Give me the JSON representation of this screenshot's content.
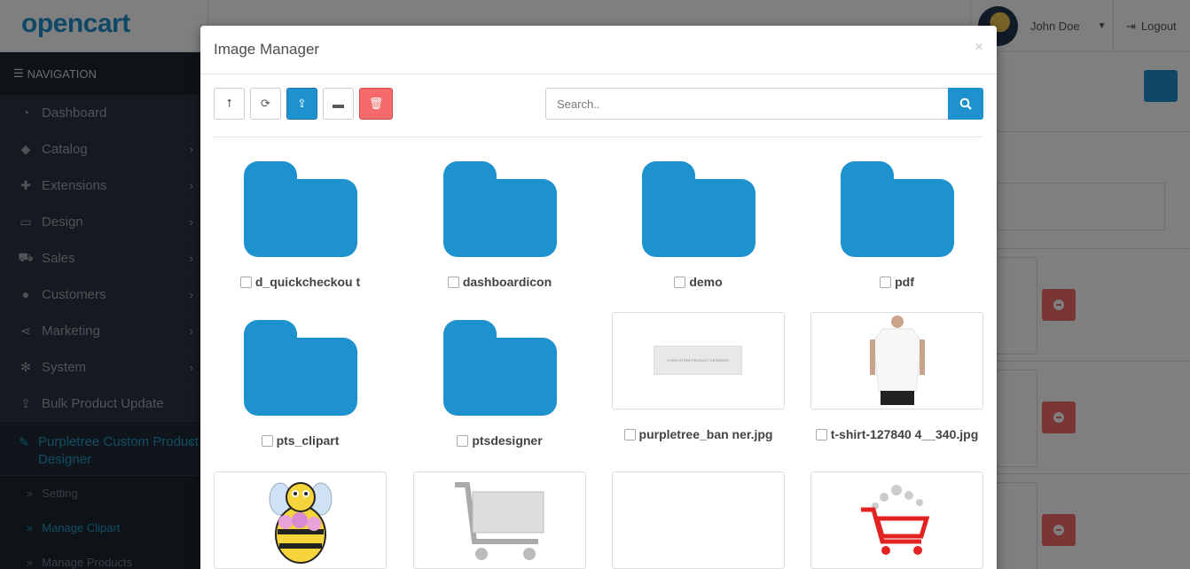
{
  "app": {
    "logo_text": "opencart",
    "logo_cart": "⌐.:",
    "user_name": "John Doe",
    "logout_label": "Logout"
  },
  "sidebar": {
    "heading": "NAVIGATION",
    "items": [
      {
        "label": "Dashboard",
        "icon": "dashboard-icon",
        "glyph": "◔"
      },
      {
        "label": "Catalog",
        "icon": "tag-icon",
        "glyph": "◆"
      },
      {
        "label": "Extensions",
        "icon": "puzzle-icon",
        "glyph": "✚"
      },
      {
        "label": "Design",
        "icon": "monitor-icon",
        "glyph": "▭"
      },
      {
        "label": "Sales",
        "icon": "cart-icon",
        "glyph": "⛟"
      },
      {
        "label": "Customers",
        "icon": "user-icon",
        "glyph": "●"
      },
      {
        "label": "Marketing",
        "icon": "share-icon",
        "glyph": "⋖"
      },
      {
        "label": "System",
        "icon": "cog-icon",
        "glyph": "✻"
      },
      {
        "label": "Bulk Product Update",
        "icon": "upload-icon",
        "glyph": "⇪"
      },
      {
        "label": "Purpletree Custom Product Designer",
        "icon": "brush-icon",
        "glyph": "✎"
      }
    ],
    "subitems": [
      "Setting",
      "Manage Clipart",
      "Manage Products"
    ]
  },
  "modal": {
    "title": "Image Manager",
    "close": "×",
    "search_placeholder": "Search..",
    "toolbar": {
      "parent": "⭡",
      "refresh": "⟳",
      "upload": "⇪",
      "folder": "▬",
      "delete": "🗑"
    },
    "folders": [
      "d_quickcheckou t",
      "dashboardicon",
      "demo",
      "pdf",
      "pts_clipart",
      "ptsdesigner"
    ],
    "images": [
      "purpletree_ban ner.jpg",
      "t-shirt-127840 4__340.jpg"
    ],
    "banner_text": "PURPLETREE PRODUCT DESIGNER"
  },
  "colors": {
    "accent": "#1e91cf",
    "danger": "#f56b6b",
    "sidebar": "#2a3542"
  }
}
